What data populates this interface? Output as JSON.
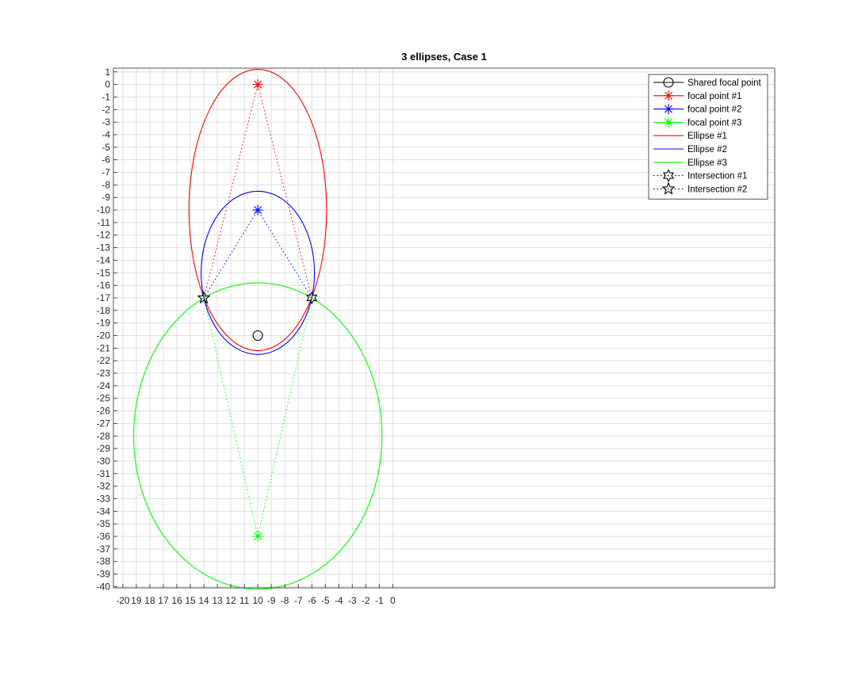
{
  "chart_data": {
    "type": "line",
    "title": "3 ellipses, Case 1",
    "xlabel": "",
    "ylabel": "",
    "xlim": [
      -20.7,
      28.3
    ],
    "ylim": [
      -40.1,
      1.3
    ],
    "xticks": [
      -20,
      -19,
      -18,
      -17,
      -16,
      -15,
      -14,
      -13,
      -12,
      -11,
      -10,
      -9,
      -8,
      -7,
      -6,
      -5,
      -4,
      -3,
      -2,
      -1,
      0
    ],
    "xtick_labels": [
      "-20",
      "19",
      "18",
      "17",
      "16",
      "15",
      "14",
      "13",
      "12",
      "11",
      "10",
      "-9",
      "-8",
      "-7",
      "-6",
      "-5",
      "-4",
      "-3",
      "-2",
      "-1",
      "0"
    ],
    "yticks": [
      1,
      0,
      -1,
      -2,
      -3,
      -4,
      -5,
      -6,
      -7,
      -8,
      -9,
      -10,
      -11,
      -12,
      -13,
      -14,
      -15,
      -16,
      -17,
      -18,
      -19,
      -20,
      -21,
      -22,
      -23,
      -24,
      -25,
      -26,
      -27,
      -28,
      -29,
      -30,
      -31,
      -32,
      -33,
      -34,
      -35,
      -36,
      -37,
      -38,
      -39,
      -40
    ],
    "grid": true,
    "legend_position": "top-right",
    "colors": {
      "red": "#ff0000",
      "blue": "#0000ff",
      "green": "#00ff00",
      "black": "#000000"
    },
    "shared_focal_point": {
      "name": "Shared focal point",
      "x": -10,
      "y": -20,
      "marker": "circle",
      "color": "#000000"
    },
    "focal_points": [
      {
        "name": "focal point #1",
        "x": -10,
        "y": 0,
        "color": "#ff0000",
        "marker": "asterisk"
      },
      {
        "name": "focal point #2",
        "x": -10,
        "y": -10,
        "color": "#0000ff",
        "marker": "asterisk"
      },
      {
        "name": "focal point #3",
        "x": -10,
        "y": -36,
        "color": "#00ff00",
        "marker": "asterisk"
      }
    ],
    "ellipses": [
      {
        "name": "Ellipse #1",
        "color": "#ff0000",
        "cx": -10,
        "cy": -10,
        "rx": 5.1,
        "ry": 11.2
      },
      {
        "name": "Ellipse #2",
        "color": "#0000ff",
        "cx": -10,
        "cy": -15,
        "rx": 4.2,
        "ry": 6.5
      },
      {
        "name": "Ellipse #3",
        "color": "#00ff00",
        "cx": -10,
        "cy": -28,
        "rx": 9.2,
        "ry": 12.2
      }
    ],
    "intersections": [
      {
        "name": "Intersection #1",
        "x": -6,
        "y": -17,
        "marker": "hexagram"
      },
      {
        "name": "Intersection #2",
        "x": -14,
        "y": -17,
        "marker": "pentagram"
      }
    ],
    "legend": [
      {
        "label": "Shared focal point",
        "color": "#000000",
        "line": "solid",
        "marker": "circle"
      },
      {
        "label": "focal point #1",
        "color": "#ff0000",
        "line": "solid",
        "marker": "asterisk"
      },
      {
        "label": "focal point #2",
        "color": "#0000ff",
        "line": "solid",
        "marker": "asterisk"
      },
      {
        "label": "focal point #3",
        "color": "#00ff00",
        "line": "solid",
        "marker": "asterisk"
      },
      {
        "label": "Ellipse #1",
        "color": "#ff0000",
        "line": "solid",
        "marker": "none"
      },
      {
        "label": "Ellipse #2",
        "color": "#0000ff",
        "line": "solid",
        "marker": "none"
      },
      {
        "label": "Ellipse #3",
        "color": "#00ff00",
        "line": "solid",
        "marker": "none"
      },
      {
        "label": "Intersection #1",
        "color": "#000000",
        "line": "dotted",
        "marker": "hexagram"
      },
      {
        "label": "Intersection #2",
        "color": "#000000",
        "line": "dotted",
        "marker": "pentagram"
      }
    ]
  }
}
